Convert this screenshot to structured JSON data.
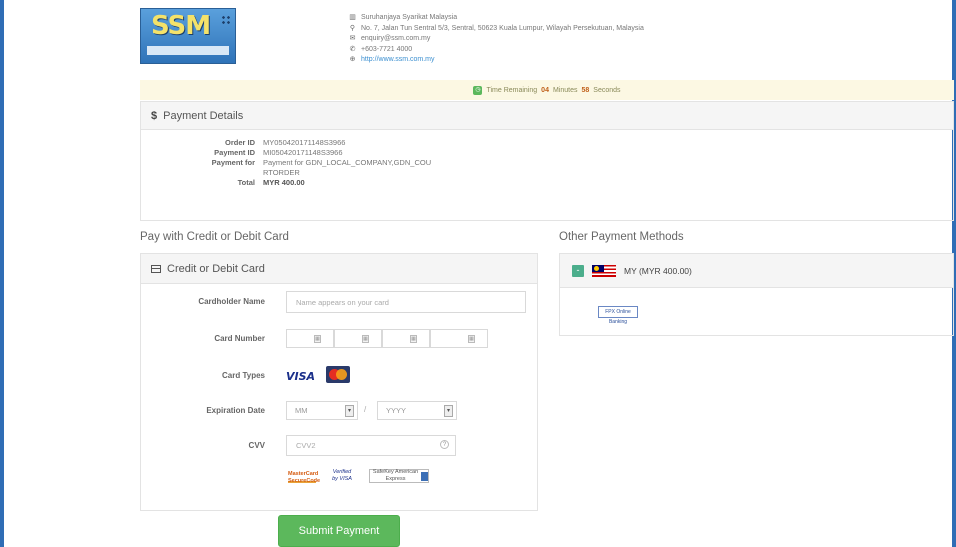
{
  "header": {
    "logo_alt": "SSM",
    "contact": [
      {
        "icon": "building-icon",
        "text": "Suruhanjaya Syarikat Malaysia"
      },
      {
        "icon": "location-icon",
        "text": "No. 7, Jalan Tun Sentral 5/3, Sentral, 50623 Kuala Lumpur, Wilayah Persekutuan, Malaysia"
      },
      {
        "icon": "mail-icon",
        "text": "enquiry@ssm.com.my"
      },
      {
        "icon": "phone-icon",
        "text": "+603-7721 4000"
      },
      {
        "icon": "globe-icon",
        "text": "http://www.ssm.com.my"
      }
    ]
  },
  "timer": {
    "label": "Time Remaining",
    "minutes": "04",
    "minutes_label": "Minutes",
    "seconds": "58",
    "seconds_label": "Seconds"
  },
  "payment_details": {
    "heading_icon": "$",
    "heading": "Payment Details",
    "rows": [
      {
        "label": "Order ID",
        "value": "MY050420171148S3966"
      },
      {
        "label": "Payment ID",
        "value": "MI050420171148S3966"
      },
      {
        "label": "Payment for",
        "value": "Payment for GDN_LOCAL_COMPANY,GDN_COURTORDER"
      },
      {
        "label": "Total",
        "value": "MYR 400.00"
      }
    ]
  },
  "card_section": {
    "title": "Pay with Credit or Debit Card",
    "panel_heading": "Credit or Debit Card",
    "cardholder_label": "Cardholder Name",
    "cardholder_placeholder": "Name appears on your card",
    "card_number_label": "Card Number",
    "card_types_label": "Card Types",
    "visa_label": "VISA",
    "expiration_label": "Expiration Date",
    "month_value": "MM",
    "year_value": "YYYY",
    "date_separator": "/",
    "cvv_label": "CVV",
    "cvv_placeholder": "CVV2",
    "secure_badges": [
      "MasterCard SecureCode",
      "Verified by VISA",
      "SafeKey American Express"
    ],
    "submit_label": "Submit Payment"
  },
  "other_methods": {
    "title": "Other Payment Methods",
    "toggle": "-",
    "country_label": "MY (MYR 400.00)",
    "fpx_label": "FPX Online Banking"
  },
  "colors": {
    "frame": "#2f6db5",
    "submit": "#5cb85c",
    "timer_bg": "#fcf8e3"
  }
}
